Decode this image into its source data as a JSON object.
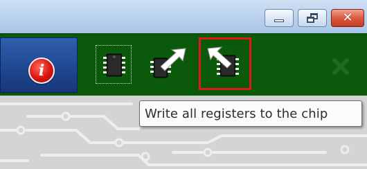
{
  "titlebar": {
    "buttons": {
      "minimize": "minimize-icon",
      "restore": "restore-icon",
      "close": "close-icon"
    }
  },
  "toolbar": {
    "info_icon": "info-icon",
    "tools": [
      {
        "name": "chip-select",
        "icon": "chip-icon"
      },
      {
        "name": "read-registers",
        "icon": "chip-read-arrow-icon"
      },
      {
        "name": "write-registers",
        "icon": "chip-write-arrow-icon",
        "highlighted": true
      },
      {
        "name": "disabled-close",
        "icon": "close-icon",
        "disabled": true
      }
    ]
  },
  "tooltip": {
    "text": "Write all registers to the chip"
  },
  "colors": {
    "toolbar_bg": "#0b5a0b",
    "info_panel": "#1e468f",
    "highlight": "#e01818"
  }
}
